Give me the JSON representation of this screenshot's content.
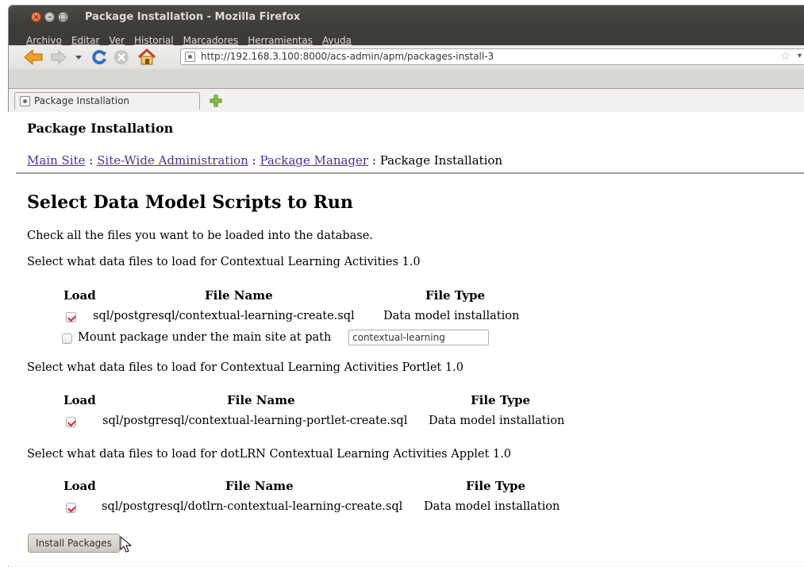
{
  "window": {
    "title": "Package Installation - Mozilla Firefox"
  },
  "menu": {
    "items": [
      "Archivo",
      "Editar",
      "Ver",
      "Historial",
      "Marcadores",
      "Herramientas",
      "Ayuda"
    ]
  },
  "urlbar": {
    "url": "http://192.168.3.100:8000/acs-admin/apm/packages-install-3"
  },
  "tab": {
    "label": "Package Installation"
  },
  "page": {
    "title": "Package Installation",
    "breadcrumb": {
      "main_site": "Main Site",
      "sep": ":",
      "site_wide": "Site-Wide Administration",
      "package_manager": "Package Manager",
      "current": "Package Installation"
    },
    "heading": "Select Data Model Scripts to Run",
    "intro": "Check all the files you want to be loaded into the database.",
    "table_headers": {
      "load": "Load",
      "file_name": "File Name",
      "file_type": "File Type"
    },
    "sections": [
      {
        "intro": "Select what data files to load for Contextual Learning Activities 1.0",
        "file": "sql/postgresql/contextual-learning-create.sql",
        "type": "Data model installation",
        "checked": true,
        "mount_label": "Mount package under the main site at path",
        "mount_value": "contextual-learning",
        "mount_checked": false
      },
      {
        "intro": "Select what data files to load for Contextual Learning Activities Portlet 1.0",
        "file": "sql/postgresql/contextual-learning-portlet-create.sql",
        "type": "Data model installation",
        "checked": true
      },
      {
        "intro": "Select what data files to load for dotLRN Contextual Learning Activities Applet 1.0",
        "file": "sql/postgresql/dotlrn-contextual-learning-create.sql",
        "type": "Data model installation",
        "checked": true
      }
    ],
    "install_button": "Install Packages"
  },
  "colors": {
    "link": "#4e2fa3",
    "titlebar": "#3c3b37",
    "check": "#d8233e"
  }
}
